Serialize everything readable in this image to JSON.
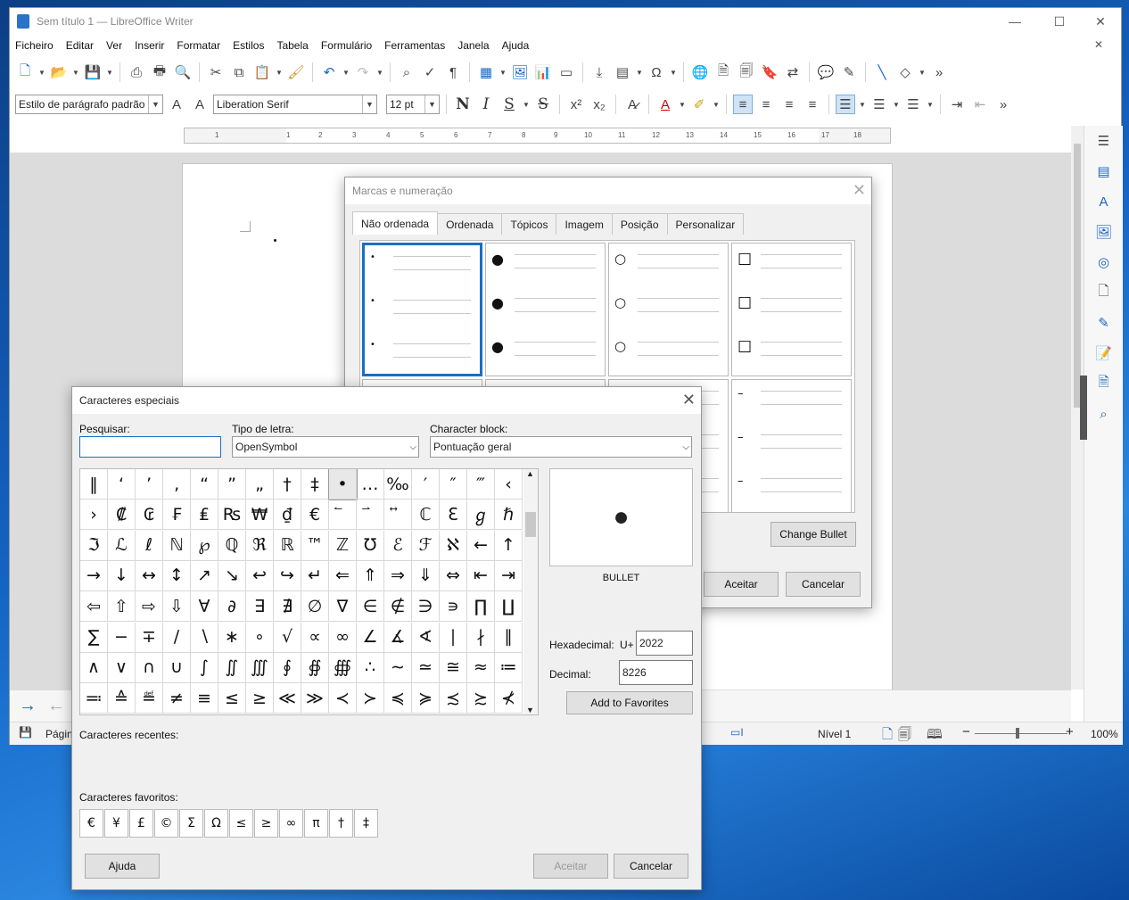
{
  "window": {
    "title": "Sem título 1 — LibreOffice Writer"
  },
  "menu": [
    "Ficheiro",
    "Editar",
    "Ver",
    "Inserir",
    "Formatar",
    "Estilos",
    "Tabela",
    "Formulário",
    "Ferramentas",
    "Janela",
    "Ajuda"
  ],
  "format_bar": {
    "paragraph_style": "Estilo de parágrafo padrão",
    "font_name": "Liberation Serif",
    "font_size": "12 pt"
  },
  "ruler_numbers": [
    "1",
    "1",
    "2",
    "3",
    "4",
    "5",
    "6",
    "7",
    "8",
    "9",
    "10",
    "11",
    "12",
    "13",
    "14",
    "15",
    "16",
    "17",
    "18"
  ],
  "statusbar": {
    "page": "Págin",
    "level": "Nível 1",
    "zoom": "100%"
  },
  "bullets_dialog": {
    "title": "Marcas e numeração",
    "tabs": [
      "Não ordenada",
      "Ordenada",
      "Tópicos",
      "Imagem",
      "Posição",
      "Personalizar"
    ],
    "bullet_glyphs": [
      "•",
      "●",
      "○",
      "☐",
      "",
      "",
      "",
      "–"
    ],
    "change_bullet": "Change Bullet",
    "ok": "Aceitar",
    "cancel": "Cancelar"
  },
  "special_chars": {
    "title": "Caracteres especiais",
    "search_label": "Pesquisar:",
    "search_value": "",
    "font_label": "Tipo de letra:",
    "font_value": "OpenSymbol",
    "block_label": "Character block:",
    "block_value": "Pontuação geral",
    "grid": [
      [
        "‖",
        "‘",
        "’",
        "‚",
        "“",
        "”",
        "„",
        "†",
        "‡",
        "•",
        "…",
        "‰",
        "′",
        "″",
        "‴",
        "‹"
      ],
      [
        "›",
        "₡",
        "₢",
        "₣",
        "₤",
        "₨",
        "₩",
        "₫",
        "€",
        "⃐",
        "⃑",
        "⃡",
        "ℂ",
        "ℇ",
        "ℊ",
        "ℏ"
      ],
      [
        "ℑ",
        "ℒ",
        "ℓ",
        "ℕ",
        "℘",
        "ℚ",
        "ℜ",
        "ℝ",
        "™",
        "ℤ",
        "℧",
        "ℰ",
        "ℱ",
        "ℵ",
        "←",
        "↑"
      ],
      [
        "→",
        "↓",
        "↔",
        "↕",
        "↗",
        "↘",
        "↩",
        "↪",
        "↵",
        "⇐",
        "⇑",
        "⇒",
        "⇓",
        "⇔",
        "⇤",
        "⇥"
      ],
      [
        "⇦",
        "⇧",
        "⇨",
        "⇩",
        "∀",
        "∂",
        "∃",
        "∄",
        "∅",
        "∇",
        "∈",
        "∉",
        "∋",
        "∍",
        "∏",
        "∐"
      ],
      [
        "∑",
        "−",
        "∓",
        "∕",
        "∖",
        "∗",
        "∘",
        "√",
        "∝",
        "∞",
        "∠",
        "∡",
        "∢",
        "∣",
        "∤",
        "∥"
      ],
      [
        "∧",
        "∨",
        "∩",
        "∪",
        "∫",
        "∬",
        "∭",
        "∮",
        "∯",
        "∰",
        "∴",
        "∼",
        "≃",
        "≅",
        "≈",
        "≔"
      ],
      [
        "≕",
        "≙",
        "≝",
        "≠",
        "≡",
        "≤",
        "≥",
        "≪",
        "≫",
        "≺",
        "≻",
        "≼",
        "≽",
        "≾",
        "≿",
        "⊀"
      ]
    ],
    "preview_char": "●",
    "char_name": "BULLET",
    "hex_label": "Hexadecimal:",
    "hex_prefix": "U+",
    "hex_value": "2022",
    "dec_label": "Decimal:",
    "dec_value": "8226",
    "add_favorites": "Add to Favorites",
    "recent_label": "Caracteres recentes:",
    "favorites_label": "Caracteres favoritos:",
    "favorites": [
      "€",
      "¥",
      "£",
      "©",
      "Σ",
      "Ω",
      "≤",
      "≥",
      "∞",
      "π",
      "†",
      "‡"
    ],
    "help": "Ajuda",
    "ok": "Aceitar",
    "cancel": "Cancelar"
  }
}
